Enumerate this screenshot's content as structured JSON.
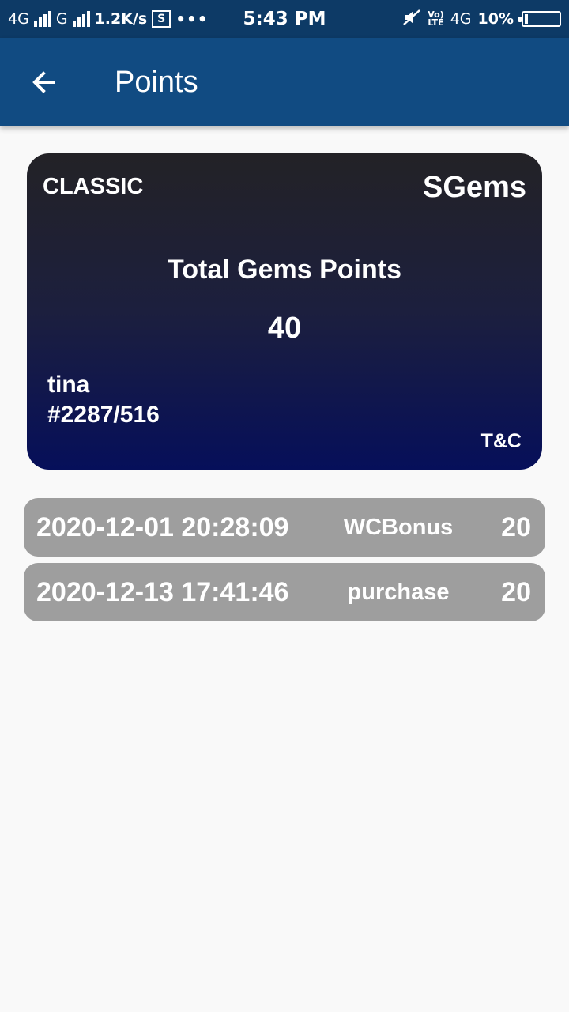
{
  "status_bar": {
    "network1": "4G",
    "network2": "G",
    "speed": "1.2K/s",
    "screenshot_icon_label": "S",
    "more": "•••",
    "time": "5:43 PM",
    "volte_top": "Vo)",
    "volte_bottom": "LTE",
    "network3": "4G",
    "battery": "10%",
    "battery_level": 0.1
  },
  "app_bar": {
    "title": "Points",
    "back_icon": "arrow-left-icon",
    "background": "#114b82"
  },
  "card": {
    "tier": "CLASSIC",
    "brand": "SGems",
    "heading": "Total Gems Points",
    "total": "40",
    "user": "tina",
    "member_id": "#2287/516",
    "terms": "T&C"
  },
  "history": [
    {
      "date": "2020-12-01 20:28:09",
      "type": "WCBonus",
      "points": "20"
    },
    {
      "date": "2020-12-13 17:41:46",
      "type": "purchase",
      "points": "20"
    }
  ],
  "colors": {
    "status_bar": "#0d3a66",
    "row_background": "#9e9e9e",
    "card_gradient_top": "#232226",
    "card_gradient_bottom": "#060f5a"
  }
}
